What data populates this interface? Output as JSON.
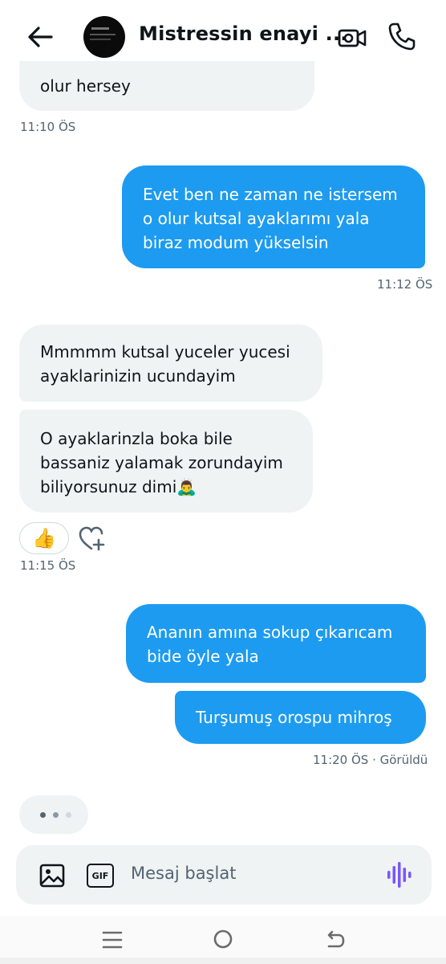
{
  "header": {
    "title": "Mistressin enayi ...",
    "icons": [
      "back-arrow-icon",
      "video-camera-icon",
      "phone-icon"
    ]
  },
  "messages": [
    {
      "dir": "in",
      "text": "olur hersey",
      "time": "11:10 ÖS"
    },
    {
      "dir": "out",
      "lines": [
        "Evet ben ne zaman ne istersem",
        "o olur kutsal ayaklarımı yala",
        "biraz modum yükselsin"
      ],
      "time": "11:12 ÖS"
    },
    {
      "dir": "in",
      "lines": [
        "Mmmmm kutsal yuceler yucesi",
        "ayaklarinizin ucundayim"
      ]
    },
    {
      "dir": "in",
      "lines": [
        "O ayaklarinzla boka bile",
        "bassaniz yalamak zorundayim",
        "biliyorsunuz dimi🙇‍♂️"
      ],
      "reaction": "👍",
      "time": "11:15 ÖS"
    },
    {
      "dir": "out",
      "lines": [
        "Ananın amına sokup çıkarıcam",
        "bide öyle yala"
      ]
    },
    {
      "dir": "out",
      "text": "Turşumuş orospu mihroş",
      "time": "11:20 ÖS · Görüldü"
    }
  ],
  "composer": {
    "placeholder": "Mesaj başlat",
    "gif_label": "GIF"
  },
  "colors": {
    "outgoing": "#1d9bf0",
    "incoming": "#eff3f4",
    "voice": "#7856ff"
  }
}
